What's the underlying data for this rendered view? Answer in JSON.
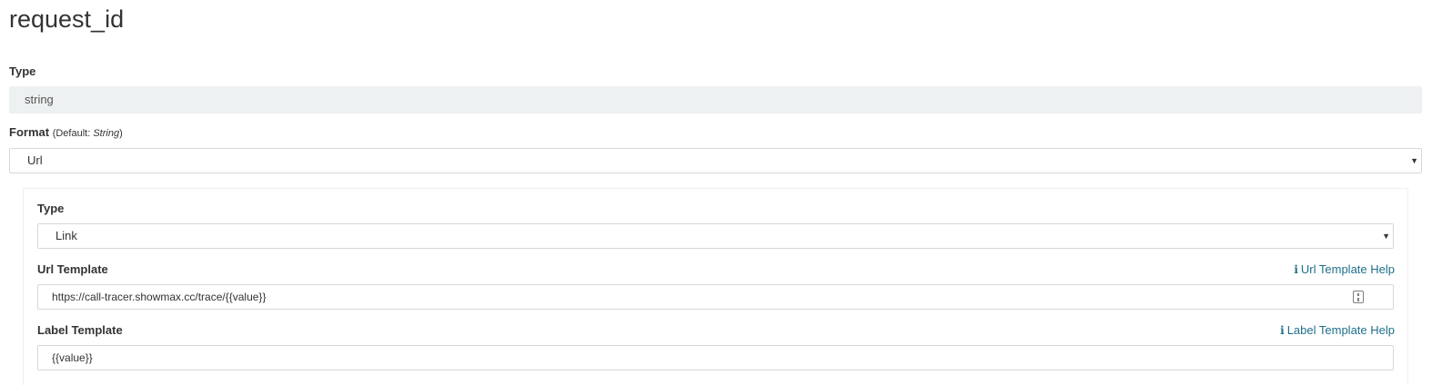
{
  "field": {
    "name": "request_id"
  },
  "type_section": {
    "label": "Type",
    "value": "string"
  },
  "format_section": {
    "label": "Format",
    "hint_prefix": "(Default: ",
    "hint_default": "String",
    "hint_suffix": ")",
    "selected": "Url"
  },
  "url_panel": {
    "type": {
      "label": "Type",
      "selected": "Link"
    },
    "url_template": {
      "label": "Url Template",
      "value": "https://call-tracer.showmax.cc/trace/{{value}}",
      "help_label": "Url Template Help"
    },
    "label_template": {
      "label": "Label Template",
      "value": "{{value}}",
      "help_label": "Label Template Help"
    }
  },
  "icons": {
    "caret": "caret-down-icon",
    "info": "info-icon",
    "field_picker": "field-picker-icon"
  },
  "colors": {
    "link": "#1f6f8b",
    "readonly_bg": "#eef1f2",
    "border": "#d5d8da"
  }
}
